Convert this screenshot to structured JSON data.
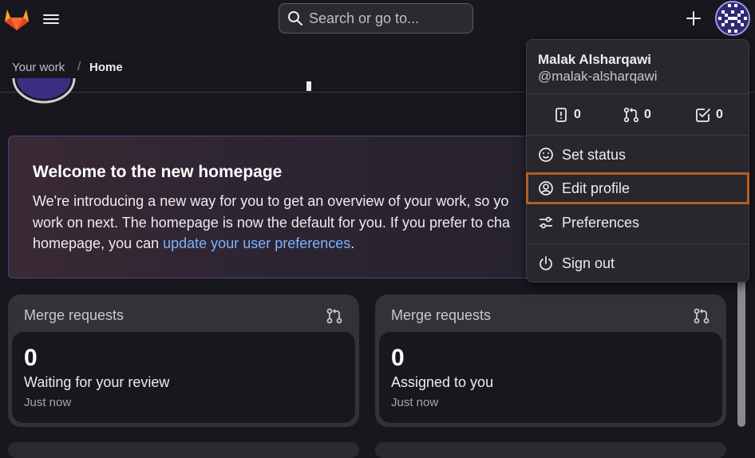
{
  "header": {
    "search_placeholder": "Search or go to...",
    "logo_icon": "gitlab-tanuki-icon",
    "menu_icon": "hamburger-icon",
    "create_icon": "plus-icon"
  },
  "breadcrumb": {
    "items": [
      "Your work",
      "Home"
    ],
    "separator": "/"
  },
  "banner": {
    "title": "Welcome to the new homepage",
    "line1": "We're introducing a new way for you to get an overview of your work, so yo",
    "line2": "work on next. The homepage is now the default for you. If you prefer to cha",
    "line3_prefix": "homepage, you can ",
    "link_text": "update your user preferences",
    "line3_suffix": "."
  },
  "cards": [
    {
      "title": "Merge requests",
      "count": "0",
      "label": "Waiting for your review",
      "time": "Just now"
    },
    {
      "title": "Merge requests",
      "count": "0",
      "label": "Assigned to you",
      "time": "Just now"
    }
  ],
  "user_menu": {
    "name": "Malak Alsharqawi",
    "username": "@malak-alsharqawi",
    "stats": [
      {
        "icon": "issues-icon",
        "count": "0"
      },
      {
        "icon": "merge-request-icon",
        "count": "0"
      },
      {
        "icon": "todo-icon",
        "count": "0"
      }
    ],
    "items": [
      {
        "icon": "smiley-icon",
        "label": "Set status"
      },
      {
        "icon": "user-icon",
        "label": "Edit profile",
        "focused": true
      },
      {
        "icon": "preferences-icon",
        "label": "Preferences"
      },
      {
        "icon": "power-icon",
        "label": "Sign out"
      }
    ]
  },
  "colors": {
    "background": "#18171d",
    "focus_outline": "#b35e23",
    "link": "#7db3ff",
    "banner_border": "#4b4584"
  }
}
